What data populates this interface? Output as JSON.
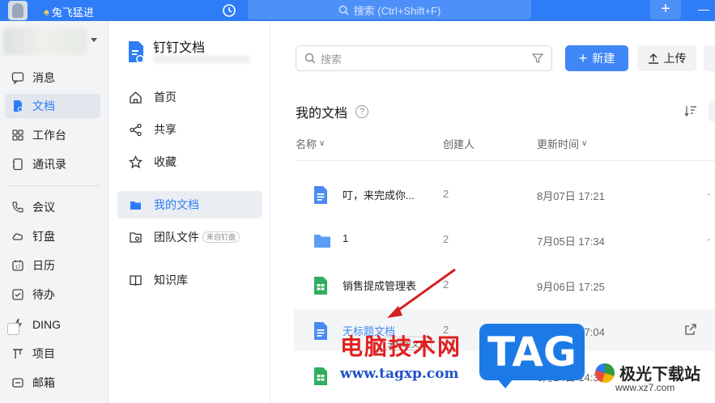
{
  "titlebar": {
    "username": "兔飞猛进",
    "search_placeholder": "搜索 (Ctrl+Shift+F)",
    "plus_label": "+"
  },
  "leftnav": {
    "items": [
      {
        "label": "消息",
        "icon": "message-icon"
      },
      {
        "label": "文档",
        "icon": "doc-icon",
        "active": true
      },
      {
        "label": "工作台",
        "icon": "grid-icon"
      },
      {
        "label": "通讯录",
        "icon": "contacts-icon"
      },
      {
        "label": "会议",
        "icon": "phone-icon"
      },
      {
        "label": "钉盘",
        "icon": "cloud-icon"
      },
      {
        "label": "日历",
        "icon": "calendar-icon"
      },
      {
        "label": "待办",
        "icon": "todo-icon"
      },
      {
        "label": "DING",
        "icon": "bolt-icon"
      },
      {
        "label": "项目",
        "icon": "project-icon"
      },
      {
        "label": "邮箱",
        "icon": "mail-icon"
      }
    ]
  },
  "midpanel": {
    "title": "钉钉文档",
    "items": [
      {
        "label": "首页",
        "icon": "home-icon"
      },
      {
        "label": "共享",
        "icon": "share-icon"
      },
      {
        "label": "收藏",
        "icon": "star-icon"
      },
      {
        "label": "我的文档",
        "icon": "folder-icon",
        "active": true
      },
      {
        "label": "团队文件",
        "icon": "team-folder-icon",
        "badge": "来自钉盘"
      },
      {
        "label": "知识库",
        "icon": "book-icon"
      }
    ]
  },
  "main": {
    "search_placeholder": "搜索",
    "new_button": "新建",
    "upload_button": "上传",
    "section_title": "我的文档",
    "help": "?",
    "columns": {
      "name": "名称",
      "creator": "创建人",
      "updated": "更新时间"
    },
    "rows": [
      {
        "name": "叮，来完成你...",
        "creator": "2",
        "time": "8月07日 17:21",
        "type": "doc"
      },
      {
        "name": "1",
        "creator": "2",
        "time": "7月05日 17:34",
        "type": "folder"
      },
      {
        "name": "销售提成管理表",
        "creator": "2",
        "time": "9月06日 17:25",
        "type": "sheet"
      },
      {
        "name": "无标题文档",
        "creator": "2",
        "time": "9月03日 17:04",
        "type": "doc",
        "hint": "无标题文档"
      },
      {
        "name": "",
        "creator": "",
        "time": "6月24日 14:30",
        "type": "sheet"
      }
    ]
  },
  "watermarks": {
    "cn": "电脑技术网",
    "url": "www.tagxp.com",
    "tag": "TAG",
    "xz": "极光下载站",
    "xz_url": "www.xz7.com"
  },
  "colors": {
    "accent": "#2e7cf6",
    "titlebar": "#2e7cf6",
    "watermark_red": "#e02020"
  }
}
